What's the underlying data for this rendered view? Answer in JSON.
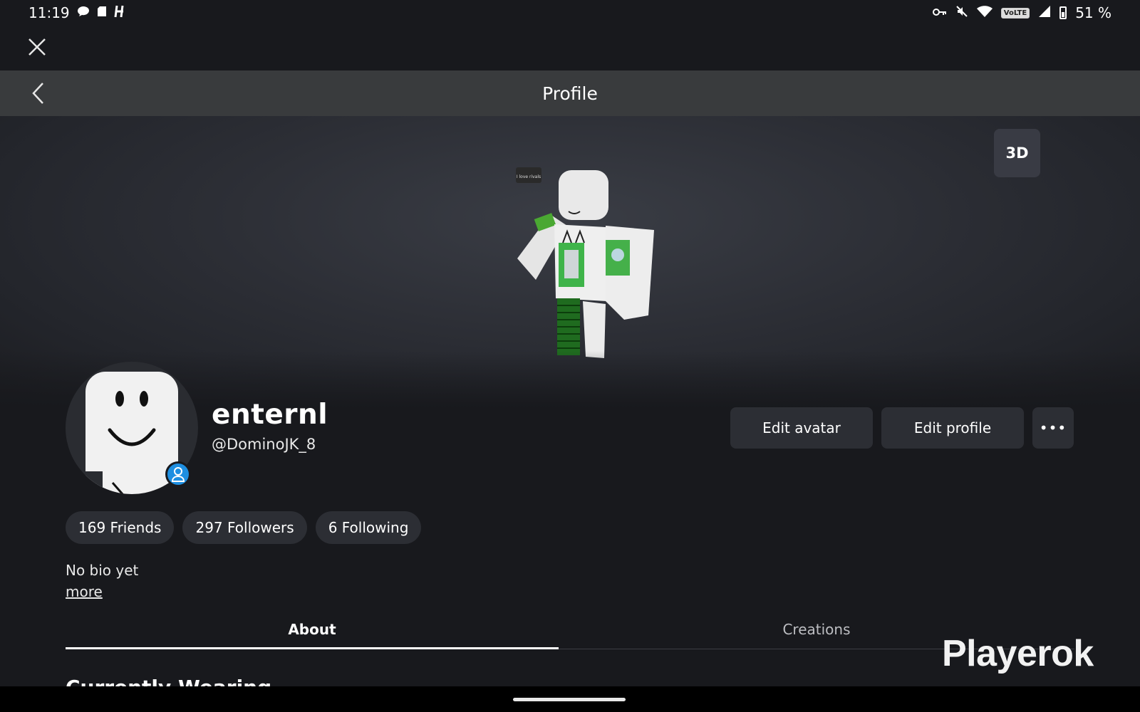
{
  "status_bar": {
    "time": "11:19",
    "battery_percent": "51 %",
    "left_icons": [
      "chat-icon",
      "sd-card-icon",
      "h-app-icon"
    ],
    "right_icons": [
      "vpn-key-icon",
      "mute-icon",
      "wifi-icon",
      "volte-icon",
      "signal-icon",
      "battery-icon"
    ],
    "volte_label": "VoLTE"
  },
  "header": {
    "title": "Profile"
  },
  "hero": {
    "view_3d_label": "3D",
    "speech_bubble_text": "I love rivals"
  },
  "profile": {
    "display_name": "enternl",
    "username": "@DominoJK_8"
  },
  "actions": {
    "edit_avatar": "Edit avatar",
    "edit_profile": "Edit profile",
    "more": "•••"
  },
  "stats": [
    {
      "label": "169 Friends"
    },
    {
      "label": "297 Followers"
    },
    {
      "label": "6 Following"
    }
  ],
  "bio": {
    "text": "No bio yet",
    "more_label": "more"
  },
  "tabs": [
    {
      "label": "About",
      "active": true
    },
    {
      "label": "Creations",
      "active": false
    }
  ],
  "section": {
    "title": "Currently Wearing"
  },
  "watermark": "Playerok",
  "colors": {
    "background": "#18191d",
    "header": "#393b3d",
    "pill": "#2c2e34",
    "badge": "#1e8fe1"
  }
}
